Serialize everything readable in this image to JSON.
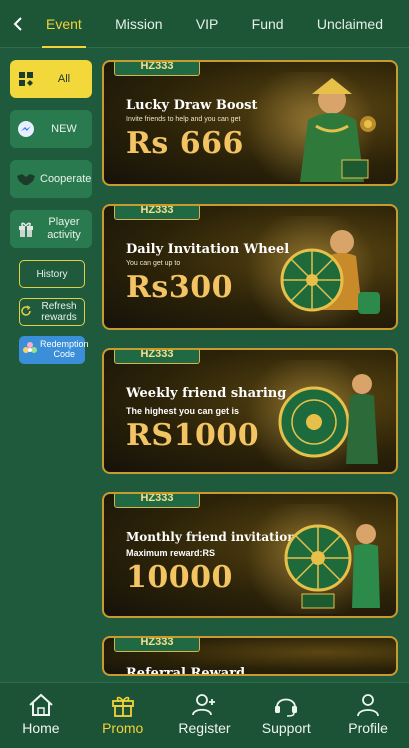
{
  "header": {
    "tabs": [
      {
        "label": "Event",
        "active": true
      },
      {
        "label": "Mission"
      },
      {
        "label": "VIP"
      },
      {
        "label": "Fund"
      },
      {
        "label": "Unclaimed"
      }
    ]
  },
  "sidebar": {
    "items": [
      {
        "label": "All",
        "icon": "grid-icon",
        "active": true
      },
      {
        "label": "NEW",
        "icon": "messenger-icon"
      },
      {
        "label": "Cooperate",
        "icon": "handshake-icon"
      },
      {
        "label": "Player activity",
        "icon": "gift-icon"
      }
    ],
    "history_label": "History",
    "refresh_label": "Refresh rewards",
    "redeem_label": "Redemption Code"
  },
  "banners": [
    {
      "brand": "HZ333",
      "title": "Lucky Draw Boost",
      "subtitle": "Invite friends to help and you can get",
      "amount": "Rs 666"
    },
    {
      "brand": "HZ333",
      "title": "Daily Invitation Wheel",
      "subtitle": "You can get up to",
      "amount": "Rs300"
    },
    {
      "brand": "HZ333",
      "title": "Weekly friend sharing",
      "subtitle": "The highest you can get is",
      "amount": "RS1000"
    },
    {
      "brand": "HZ333",
      "title": "Monthly friend invitations",
      "subtitle": "Maximum reward:RS",
      "amount": "10000"
    },
    {
      "brand": "HZ333",
      "title": "Referral Reward"
    }
  ],
  "bottom_nav": [
    {
      "label": "Home",
      "icon": "home-icon"
    },
    {
      "label": "Promo",
      "icon": "gift-icon",
      "active": true
    },
    {
      "label": "Register",
      "icon": "add-user-icon"
    },
    {
      "label": "Support",
      "icon": "headset-icon"
    },
    {
      "label": "Profile",
      "icon": "user-icon"
    }
  ],
  "colors": {
    "background": "#1f5a3c",
    "accent": "#f4d23a",
    "banner_border": "#c99b2f",
    "amount_gold": "#f3c463"
  }
}
